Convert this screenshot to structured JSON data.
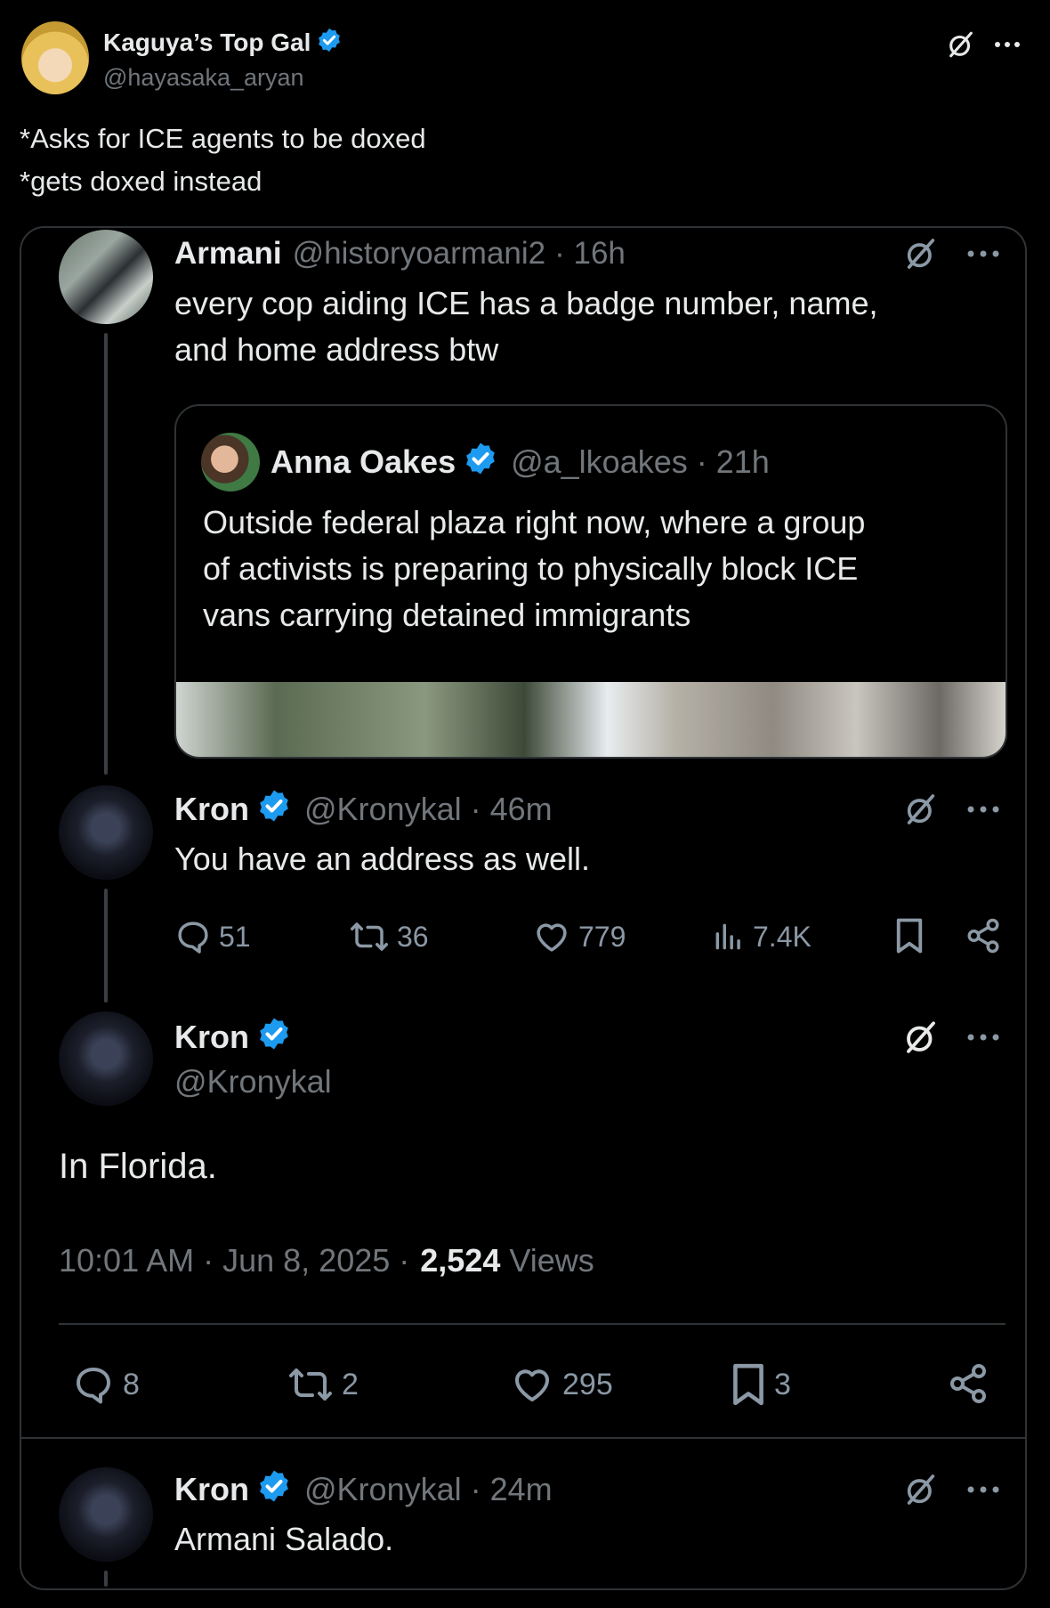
{
  "top_post": {
    "display_name": "Kaguya’s Top Gal",
    "handle": "@hayasaka_aryan",
    "text_line1": "*Asks for ICE agents to be doxed",
    "text_line2": "*gets doxed instead"
  },
  "armani_post": {
    "display_name": "Armani",
    "handle": "@historyoarmani2",
    "time": "· 16h",
    "text_line1": "every cop aiding ICE has a badge number, name,",
    "text_line2": "and home address btw"
  },
  "quoted_post": {
    "display_name": "Anna Oakes",
    "handle": "@a_lkoakes",
    "time": "· 21h",
    "text_line1": "Outside federal plaza right now, where a group",
    "text_line2": "of activists is preparing to physically block ICE",
    "text_line3": "vans carrying detained immigrants"
  },
  "kron_reply1": {
    "display_name": "Kron",
    "handle": "@Kronykal",
    "time": "· 46m",
    "text": "You have an address as well.",
    "replies": "51",
    "reposts": "36",
    "likes": "779",
    "views": "7.4K"
  },
  "main_post": {
    "display_name": "Kron",
    "handle": "@Kronykal",
    "text": "In Florida.",
    "timestamp": "10:01 AM · Jun 8, 2025 ·",
    "views_count": "2,524",
    "views_label": "Views",
    "replies": "8",
    "reposts": "2",
    "likes": "295",
    "bookmarks": "3"
  },
  "kron_reply2": {
    "display_name": "Kron",
    "handle": "@Kronykal",
    "time": "· 24m",
    "text": "Armani Salado."
  },
  "colors": {
    "background": "#000000",
    "text": "#e7e9ea",
    "muted": "#71767b",
    "verified": "#1d9bf0",
    "border": "#2f3336"
  }
}
